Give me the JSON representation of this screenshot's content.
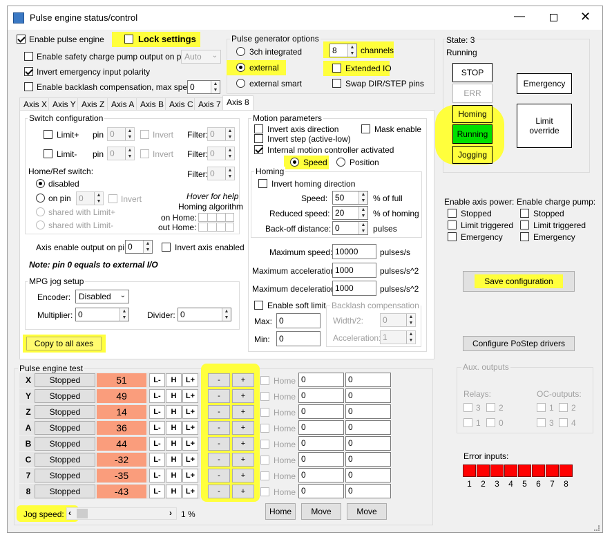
{
  "window": {
    "title": "Pulse engine status/control"
  },
  "top": {
    "enable_pulse_engine": "Enable pulse engine",
    "lock_settings": "Lock settings",
    "safety_pump": "Enable safety charge pump output on pin",
    "safety_pump_value": "Auto",
    "invert_emergency": "Invert emergency input polarity",
    "backlash": "Enable backlash compensation, max speed:",
    "backlash_value": "0"
  },
  "pulse_gen": {
    "title": "Pulse generator options",
    "opt_3ch": "3ch integrated",
    "opt_external": "external",
    "opt_external_smart": "external smart",
    "channels_value": "8",
    "channels_label": "channels",
    "extended_io": "Extended IO",
    "swap_dir": "Swap DIR/STEP pins"
  },
  "tabs": [
    "Axis X",
    "Axis Y",
    "Axis Z",
    "Axis A",
    "Axis B",
    "Axis C",
    "Axis 7",
    "Axis 8"
  ],
  "switch_config": {
    "title": "Switch configuration",
    "limit_plus": "Limit+",
    "limit_minus": "Limit-",
    "pin": "pin",
    "pin_value": "0",
    "invert": "Invert",
    "filter": "Filter:",
    "filter_value": "0",
    "home_ref": "Home/Ref switch:",
    "disabled": "disabled",
    "on_pin": "on pin",
    "shared_plus": "shared with Limit+",
    "shared_minus": "shared with Limit-",
    "hover_help": "Hover for help",
    "homing_algorithm": "Homing algorithm",
    "on_home": "on Home:",
    "out_home": "out Home:"
  },
  "axis_enable": {
    "label": "Axis enable output on pin",
    "value": "0",
    "invert": "Invert axis enabled",
    "note": "Note: pin 0 equals to external I/O"
  },
  "mpg": {
    "title": "MPG jog setup",
    "encoder": "Encoder:",
    "encoder_value": "Disabled",
    "multiplier": "Multiplier:",
    "multiplier_value": "0",
    "divider": "Divider:",
    "divider_value": "0"
  },
  "copy_all": "Copy to all axes",
  "motion": {
    "title": "Motion parameters",
    "invert_dir": "Invert axis direction",
    "mask_enable": "Mask enable",
    "invert_step": "Invert step (active-low)",
    "internal_motion": "Internal motion controller activated",
    "speed": "Speed",
    "position": "Position",
    "max_speed": "Maximum speed:",
    "max_speed_value": "10000",
    "max_speed_unit": "pulses/s",
    "max_accel": "Maximum acceleration:",
    "max_accel_value": "1000",
    "max_accel_unit": "pulses/s^2",
    "max_decel": "Maximum deceleration:",
    "max_decel_value": "1000",
    "max_decel_unit": "pulses/s^2",
    "soft_limit": "Enable soft limit",
    "max": "Max:",
    "max_value": "0",
    "min": "Min:",
    "min_value": "0",
    "backlash_comp": "Backlash compensation",
    "width2": "Width/2:",
    "width2_value": "0",
    "acceleration": "Acceleration:",
    "acceleration_value": "1"
  },
  "homing": {
    "title": "Homing",
    "invert_dir": "Invert homing direction",
    "speed": "Speed:",
    "speed_value": "50",
    "speed_unit": "% of full",
    "reduced": "Reduced speed:",
    "reduced_value": "20",
    "reduced_unit": "% of homing",
    "backoff": "Back-off distance:",
    "backoff_value": "0",
    "backoff_unit": "pulses"
  },
  "state": {
    "label": "State: 3",
    "status": "Running",
    "stop": "STOP",
    "err": "ERR",
    "homing": "Homing",
    "running": "Running",
    "jogging": "Jogging",
    "emergency": "Emergency",
    "limit_override": "Limit override"
  },
  "axis_power": {
    "title": "Enable axis power:",
    "stopped": "Stopped",
    "limit": "Limit triggered",
    "emergency": "Emergency"
  },
  "charge_pump": {
    "title": "Enable charge pump:",
    "stopped": "Stopped",
    "limit": "Limit triggered",
    "emergency": "Emergency"
  },
  "save_config": "Save configuration",
  "configure_postep": "Configure PoStep drivers",
  "aux": {
    "title": "Aux. outputs",
    "relays": "Relays:",
    "oc": "OC-outputs:",
    "r3": "3",
    "r2": "2",
    "r1": "1",
    "r0": "0",
    "o1": "1",
    "o2": "2",
    "o3": "3",
    "o4": "4"
  },
  "error_inputs": {
    "title": "Error inputs:",
    "labels": [
      "1",
      "2",
      "3",
      "4",
      "5",
      "6",
      "7",
      "8"
    ]
  },
  "test": {
    "title": "Pulse engine test",
    "rows": [
      {
        "axis": "X",
        "status": "Stopped",
        "value": "51"
      },
      {
        "axis": "Y",
        "status": "Stopped",
        "value": "49"
      },
      {
        "axis": "Z",
        "status": "Stopped",
        "value": "14"
      },
      {
        "axis": "A",
        "status": "Stopped",
        "value": "36"
      },
      {
        "axis": "B",
        "status": "Stopped",
        "value": "44"
      },
      {
        "axis": "C",
        "status": "Stopped",
        "value": "-32"
      },
      {
        "axis": "7",
        "status": "Stopped",
        "value": "-35"
      },
      {
        "axis": "8",
        "status": "Stopped",
        "value": "-43"
      }
    ],
    "lminus": "L-",
    "h": "H",
    "lplus": "L+",
    "minus": "-",
    "plus": "+",
    "home": "Home",
    "field_value": "0",
    "home_button": "Home",
    "move1": "Move",
    "move2": "Move",
    "jog_speed": "Jog speed:",
    "jog_value": "1 %"
  },
  "colors": {
    "highlight": "#ffff3c",
    "running": "#00e000",
    "error": "#ff0000",
    "value_bg": "#fa9d7c"
  }
}
